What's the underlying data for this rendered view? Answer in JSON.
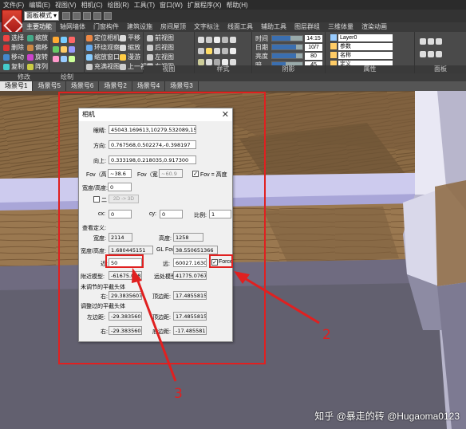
{
  "app": {
    "menu": [
      "文件(F)",
      "编辑(E)",
      "视图(V)",
      "相机(C)",
      "绘图(R)",
      "工具(T)",
      "窗口(W)",
      "扩展程序(X)",
      "帮助(H)"
    ],
    "mode": "面板模式",
    "ribbon_tabs": [
      "主要功能",
      "轴网墙体",
      "门窗构件",
      "建筑设施",
      "房间屋顶",
      "文字标注",
      "线面工具",
      "辅助工具",
      "图层群组",
      "三维体量",
      "渲染动画"
    ],
    "ribbon_groups": {
      "modify": {
        "label": "修改",
        "buttons": [
          "选择",
          "缩放",
          "删除",
          "偏移",
          "移动",
          "旋转",
          "复制",
          "阵列"
        ]
      },
      "draw": {
        "label": "绘制"
      },
      "view_left": {
        "buttons": [
          "定位相机",
          "平移",
          "环绕观察",
          "缩放",
          "缩放窗口",
          "漫游",
          "充满视图",
          "上一视图"
        ]
      },
      "view": {
        "label": "视图",
        "buttons": [
          "前视图",
          "后视图",
          "左视图",
          "右视图"
        ]
      },
      "style": {
        "label": "样式"
      },
      "shadow": {
        "label": "阴影",
        "rows": [
          {
            "label": "时间",
            "value": "14:15",
            "fill": 0.6
          },
          {
            "label": "日期",
            "value": "10/7",
            "fill": 0.78
          },
          {
            "label": "亮度",
            "value": "80",
            "fill": 0.8
          },
          {
            "label": "暗",
            "value": "45",
            "fill": 0.45
          }
        ]
      },
      "props": {
        "label": "属性",
        "layer": "Layer0",
        "rows": [
          "参数",
          "名称",
          "定义"
        ]
      },
      "panel": {
        "label": "面板"
      }
    },
    "scene_tabs": [
      "场景号1",
      "场景号5",
      "场景号6",
      "场景号2",
      "场景号4",
      "场景号3"
    ]
  },
  "dialog": {
    "title": "相机",
    "eye_label": "眼睛:",
    "eye_value": "45043.169613,10279.532089,158.1722",
    "dir_label": "方向:",
    "dir_value": "0.767568,0.502274,-0.398197",
    "up_label": "向上:",
    "up_value": "0.333198,0.218035,0.917300",
    "fov_h_label": "Fov（高",
    "fov_h_value": "~38.6",
    "fov_w_label": "Fov（宽",
    "fov_w_value": "~60.9",
    "fov_eq_label": "Fov = 高度",
    "aspect_label": "宽度/高度:",
    "aspect_value": "0",
    "two_d_label": "二",
    "two_d_button": "2D -> 3D",
    "cx_label": "cx:",
    "cx_value": "0",
    "cy_label": "cy:",
    "cy_value": "0",
    "scale_label": "比例:",
    "scale_value": "1",
    "view_def_label": "查看定义:",
    "width_label": "宽度:",
    "width_value": "2114",
    "height_label": "高度:",
    "height_value": "1258",
    "wh_label": "宽度/高度:",
    "wh_value": "1.680445151",
    "glfov_label": "GL Fov:",
    "glfov_value": "38.550651366",
    "near_label": "近:",
    "near_value": "50",
    "far_label": "远:",
    "far_value": "60027.163012",
    "force_label": "Force",
    "near_model_label": "附近模型:",
    "near_model_value": "-61675.05865",
    "far_model_label": "远处模型:",
    "far_model_value": "41775.076710",
    "adj_frustum_label": "未调节的平截头体",
    "right1_label": "右:",
    "right1_value": "29.383560740",
    "top1_label": "顶边距:",
    "top1_value": "17.485581561",
    "adj2_label": "调整过的平截头体",
    "left2_label": "左边距:",
    "left2_value": "-29.383560740",
    "top2_label": "顶边距:",
    "top2_value": "17.485581561",
    "right2_label": "右:",
    "right2_value": "-29.383560740",
    "bottom2_label": "底边距:",
    "bottom2_value": "-17.485581561"
  },
  "annotations": {
    "label_2": "2",
    "label_3": "3",
    "color": "#e02020"
  },
  "credit": "知乎 @暴走的砖 @Hugaoma0123"
}
